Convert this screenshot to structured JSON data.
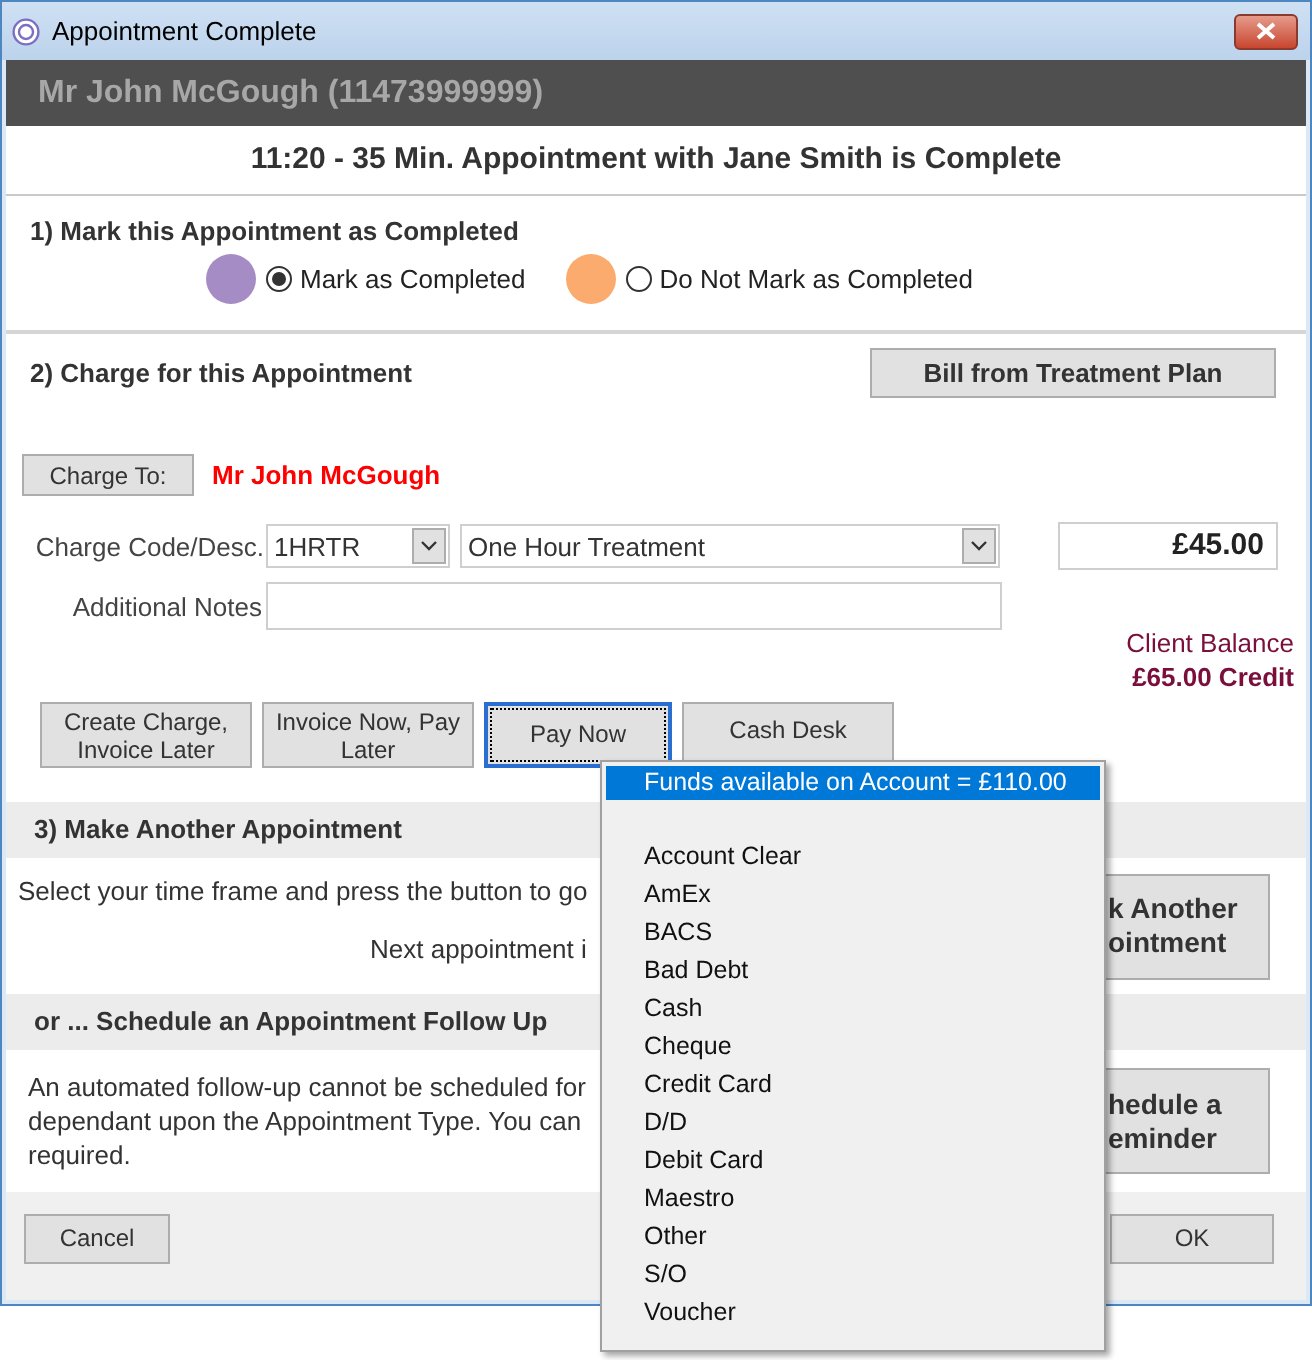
{
  "window": {
    "title": "Appointment Complete"
  },
  "patient_header": "Mr John McGough (11473999999)",
  "appointment_summary": "11:20 - 35 Min. Appointment with Jane Smith is Complete",
  "completion": {
    "heading": "1) Mark this Appointment as Completed",
    "options": [
      {
        "label": "Mark as Completed",
        "color": "#a68cc4",
        "selected": true
      },
      {
        "label": "Do Not Mark as Completed",
        "color": "#fbab6e",
        "selected": false
      }
    ]
  },
  "charge": {
    "heading": "2) Charge for this Appointment",
    "plan_button": "Bill from Treatment Plan",
    "charge_to_button": "Charge To:",
    "charge_to_name": "Mr John McGough",
    "code_label": "Charge Code/Desc.",
    "code_value": "1HRTR",
    "desc_value": "One Hour Treatment",
    "amount": "£45.00",
    "notes_label": "Additional Notes",
    "balance_label": "Client Balance",
    "balance_value": "£65.00 Credit",
    "buttons": [
      {
        "label": "Create Charge,\nInvoice Later",
        "focused": false
      },
      {
        "label": "Invoice Now, Pay\nLater",
        "focused": false
      },
      {
        "label": "Pay Now",
        "focused": true
      },
      {
        "label": "Cash Desk",
        "focused": false
      }
    ]
  },
  "another": {
    "heading": "3) Make Another Appointment",
    "text": "Select your time frame and press the button to go",
    "next_text": "Next appointment i",
    "button_lines": [
      "k Another",
      "ointment"
    ]
  },
  "follow_up": {
    "heading": "or ... Schedule an Appointment Follow Up",
    "text_lines": [
      "An automated follow-up cannot be scheduled for",
      "dependant upon the Appointment Type. You can",
      "required."
    ],
    "button_lines": [
      "hedule a",
      "eminder"
    ]
  },
  "footer": {
    "cancel": "Cancel",
    "ok": "OK"
  },
  "pay_menu": {
    "items": [
      {
        "label": "Funds available on Account = £110.00",
        "kind": "info",
        "selected": true
      },
      {
        "label": "Account Clear",
        "kind": "method",
        "selected": false
      },
      {
        "label": "AmEx",
        "kind": "method",
        "selected": false
      },
      {
        "label": "BACS",
        "kind": "method",
        "selected": false
      },
      {
        "label": "Bad Debt",
        "kind": "method",
        "selected": false
      },
      {
        "label": "Cash",
        "kind": "method",
        "selected": false
      },
      {
        "label": "Cheque",
        "kind": "method",
        "selected": false
      },
      {
        "label": "Credit Card",
        "kind": "method",
        "selected": false
      },
      {
        "label": "D/D",
        "kind": "method",
        "selected": false
      },
      {
        "label": "Debit Card",
        "kind": "method",
        "selected": false
      },
      {
        "label": "Maestro",
        "kind": "method",
        "selected": false
      },
      {
        "label": "Other",
        "kind": "method",
        "selected": false
      },
      {
        "label": "S/O",
        "kind": "method",
        "selected": false
      },
      {
        "label": "Voucher",
        "kind": "method",
        "selected": false
      }
    ]
  }
}
